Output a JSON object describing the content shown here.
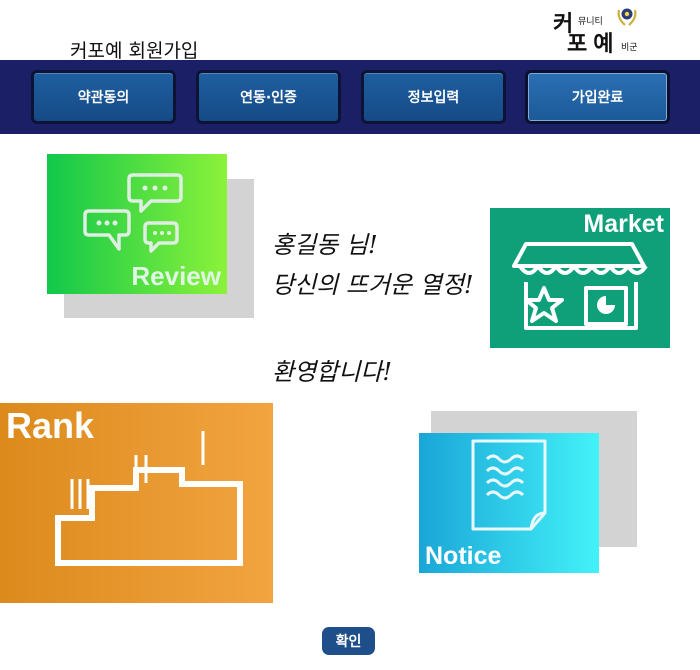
{
  "header": {
    "title": "커포예 회원가입",
    "logo": {
      "line1": "커",
      "line1_small": "뮤니티",
      "line2": "포예",
      "line2_small": "비군"
    }
  },
  "steps": [
    {
      "label": "약관동의",
      "active": false
    },
    {
      "label": "연동·인증",
      "active": false
    },
    {
      "label": "정보입력",
      "active": false
    },
    {
      "label": "가입완료",
      "active": true
    }
  ],
  "tiles": {
    "review": {
      "label": "Review",
      "icon": "chat-bubbles-icon",
      "color": "#12c84a"
    },
    "market": {
      "label": "Market",
      "icon": "storefront-icon",
      "color": "#0fa07a"
    },
    "rank": {
      "label": "Rank",
      "icon": "podium-icon",
      "color": "#dc8a1c"
    },
    "notice": {
      "label": "Notice",
      "icon": "document-icon",
      "color": "#1aa6d8"
    }
  },
  "message": {
    "line1": "홍길동 님!",
    "line2": "당신의 뜨거운 열정!",
    "line3": "환영합니다!"
  },
  "confirm_label": "확인",
  "colors": {
    "stepbar_bg": "#1b2066",
    "step_button": "#1e5fa0",
    "confirm_button": "#1f4f8a"
  }
}
